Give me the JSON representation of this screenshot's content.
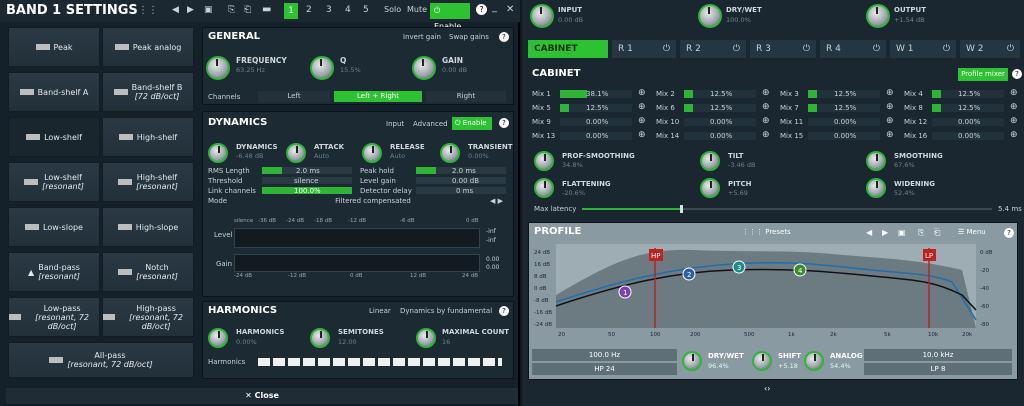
{
  "title": "BAND 1 SETTINGS",
  "pages": [
    "1",
    "2",
    "3",
    "4",
    "5"
  ],
  "header": {
    "solo": "Solo",
    "mute": "Mute",
    "enable": "Enable"
  },
  "shapes": [
    {
      "a": "Peak",
      "b": "Peak analog"
    },
    {
      "a": "Band-shelf A",
      "b": "Band-shelf B",
      "bsub": "[72 dB/oct]"
    },
    {
      "a": "Low-shelf",
      "b": "High-shelf"
    },
    {
      "a": "Low-shelf",
      "asub": "[resonant]",
      "b": "High-shelf",
      "bsub": "[resonant]"
    },
    {
      "a": "Low-slope",
      "b": "High-slope"
    },
    {
      "a": "Band-pass",
      "asub": "[resonant]",
      "b": "Notch",
      "bsub": "[resonant]"
    },
    {
      "a": "Low-pass",
      "asub": "[resonant, 72 dB/oct]",
      "b": "High-pass",
      "bsub": "[resonant, 72 dB/oct]"
    }
  ],
  "allpass": {
    "label": "All-pass",
    "sub": "[resonant, 72 dB/oct]"
  },
  "close": "Close",
  "general": {
    "title": "GENERAL",
    "invert": "Invert gain",
    "swap": "Swap gains",
    "freq": {
      "label": "FREQUENCY",
      "value": "63.25 Hz"
    },
    "q": {
      "label": "Q",
      "value": "15.5%"
    },
    "gain": {
      "label": "GAIN",
      "value": "0.00 dB"
    },
    "channels": "Channels",
    "left": "Left",
    "lr": "Left + Right",
    "right": "Right"
  },
  "dynamics": {
    "title": "DYNAMICS",
    "input": "Input",
    "advanced": "Advanced",
    "enable": "Enable",
    "dyn": {
      "label": "DYNAMICS",
      "value": "-6.48 dB"
    },
    "attack": {
      "label": "ATTACK",
      "value": "Auto"
    },
    "release": {
      "label": "RELEASE",
      "value": "Auto"
    },
    "transient": {
      "label": "TRANSIENT",
      "value": "0.00%"
    },
    "rms": "RMS Length",
    "rmsv": "2.0 ms",
    "peak": "Peak hold",
    "peakv": "2.0 ms",
    "thr": "Threshold",
    "thrv": "silence",
    "lg": "Level gain",
    "lgv": "0.00 dB",
    "link": "Link channels",
    "linkv": "100.0%",
    "dd": "Detector delay",
    "ddv": "0 ms",
    "mode": "Mode",
    "modev": "Filtered compensated",
    "scale": [
      "silence",
      "-36 dB",
      "-24 dB",
      "-18 dB",
      "-12 dB",
      "-6 dB",
      "0 dB"
    ],
    "level": "Level",
    "inf1": "-inf",
    "inf2": "-inf",
    "gain": "Gain",
    "g1": "0.00",
    "g2": "0.00",
    "scale2": [
      "-24 dB",
      "-12 dB",
      "0 dB",
      "12 dB",
      "24 dB"
    ]
  },
  "harmonics": {
    "title": "HARMONICS",
    "linear": "Linear",
    "byfund": "Dynamics by fundamental",
    "h": {
      "label": "HARMONICS",
      "value": "0.00%"
    },
    "s": {
      "label": "SEMITONES",
      "value": "12.00"
    },
    "m": {
      "label": "MAXIMAL COUNT",
      "value": "16"
    },
    "hl": "Harmonics"
  },
  "top": {
    "input": {
      "label": "INPUT",
      "value": "0.00 dB"
    },
    "drywet": {
      "label": "DRY/WET",
      "value": "100.0%"
    },
    "output": {
      "label": "OUTPUT",
      "value": "+1.54 dB"
    }
  },
  "tabs": [
    "CABINET",
    "R 1",
    "R 2",
    "R 3",
    "R 4",
    "W 1",
    "W 2"
  ],
  "cabinet": {
    "title": "CABINET",
    "mixer": "Profile mixer",
    "mix": [
      {
        "l": "Mix 1",
        "v": "38.1%",
        "f": 0.38
      },
      {
        "l": "Mix 2",
        "v": "12.5%",
        "f": 0.12
      },
      {
        "l": "Mix 3",
        "v": "12.5%",
        "f": 0.12
      },
      {
        "l": "Mix 4",
        "v": "12.5%",
        "f": 0.12
      },
      {
        "l": "Mix 5",
        "v": "12.5%",
        "f": 0.12
      },
      {
        "l": "Mix 6",
        "v": "12.5%",
        "f": 0.12
      },
      {
        "l": "Mix 7",
        "v": "12.5%",
        "f": 0.12
      },
      {
        "l": "Mix 8",
        "v": "12.5%",
        "f": 0.12
      },
      {
        "l": "Mix 9",
        "v": "0.00%",
        "f": 0
      },
      {
        "l": "Mix 10",
        "v": "0.00%",
        "f": 0
      },
      {
        "l": "Mix 11",
        "v": "0.00%",
        "f": 0
      },
      {
        "l": "Mix 12",
        "v": "0.00%",
        "f": 0
      },
      {
        "l": "Mix 13",
        "v": "0.00%",
        "f": 0
      },
      {
        "l": "Mix 14",
        "v": "0.00%",
        "f": 0
      },
      {
        "l": "Mix 15",
        "v": "0.00%",
        "f": 0
      },
      {
        "l": "Mix 16",
        "v": "0.00%",
        "f": 0
      }
    ],
    "ps": {
      "label": "PROF-SMOOTHING",
      "value": "34.8%"
    },
    "tilt": {
      "label": "TILT",
      "value": "-3.46 dB"
    },
    "sm": {
      "label": "SMOOTHING",
      "value": "67.6%"
    },
    "fl": {
      "label": "FLATTENING",
      "value": "-20.6%"
    },
    "pitch": {
      "label": "PITCH",
      "value": "+5.69"
    },
    "wid": {
      "label": "WIDENING",
      "value": "52.4%"
    },
    "lat": "Max latency",
    "latv": "5.4 ms"
  },
  "profile": {
    "title": "PROFILE",
    "presets": "Presets",
    "menu": "Menu",
    "ylab": [
      "24 dB",
      "16 dB",
      "8 dB",
      "0 dB",
      "-8 dB",
      "-16 dB",
      "-24 dB"
    ],
    "rlab": [
      "0 dB",
      "-20",
      "-40",
      "-60",
      "-80"
    ],
    "xlab": [
      "20",
      "50",
      "100",
      "200",
      "500",
      "1k",
      "2k",
      "5k",
      "10k",
      "20k"
    ],
    "hp": "HP",
    "lp": "LP",
    "nodes": [
      "1",
      "2",
      "3",
      "4"
    ]
  },
  "bottom": {
    "hpf": "100.0 Hz",
    "hp": "HP 24",
    "dw": {
      "label": "DRY/WET",
      "value": "96.4%"
    },
    "shift": {
      "label": "SHIFT",
      "value": "+5.18"
    },
    "analog": {
      "label": "ANALOG",
      "value": "54.4%"
    },
    "lpf": "10.0 kHz",
    "lp": "LP 8"
  }
}
